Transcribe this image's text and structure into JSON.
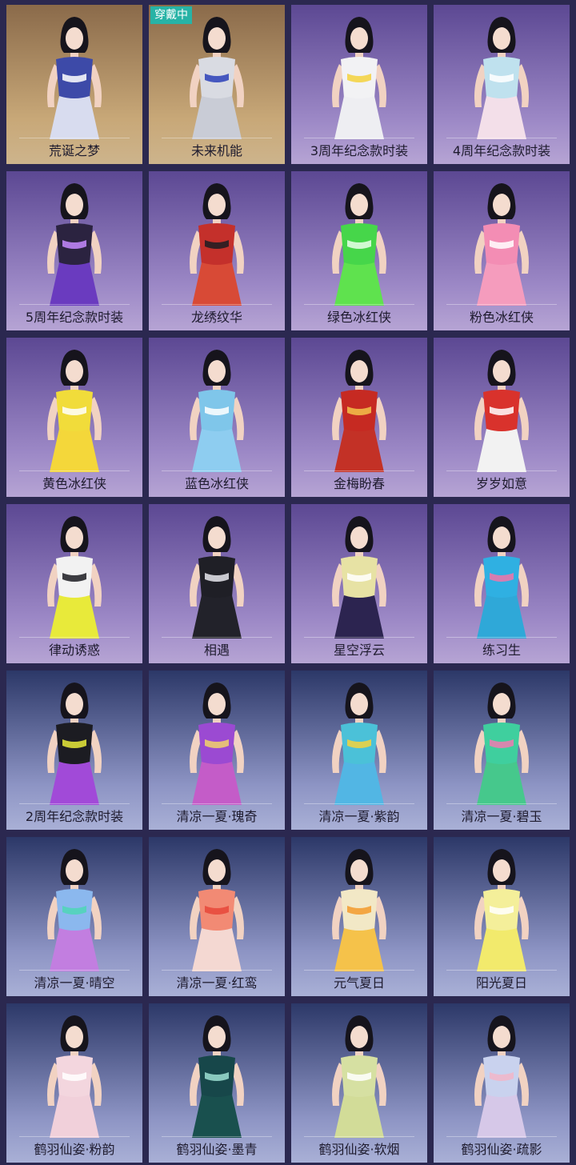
{
  "colors": {
    "page_bg": "#2b2850",
    "badge_bg": "#27b3a6",
    "label_text": "#1e1b2e"
  },
  "wearing_badge": "穿戴中",
  "outfits": [
    {
      "name": "荒诞之梦",
      "wearing": false,
      "bg_top": "#8a6a4a",
      "bg_bottom": "#c8a878",
      "label_bg": "#cdb48c",
      "top": "#3d4aa8",
      "bottom": "#d8dcef",
      "accent": "#ffffff",
      "icon": "character-portrait-icon"
    },
    {
      "name": "未来机能",
      "wearing": true,
      "bg_top": "#8a6a4a",
      "bg_bottom": "#c8a878",
      "label_bg": "#cdb48c",
      "top": "#d9dbe2",
      "bottom": "#c9ccd6",
      "accent": "#2a3fb8",
      "icon": "character-portrait-icon"
    },
    {
      "name": "3周年纪念款时装",
      "wearing": false,
      "bg_top": "#5c4893",
      "bg_bottom": "#9c88c6",
      "label_bg": "#b6a4d4",
      "top": "#f2f2f4",
      "bottom": "#eeeef2",
      "accent": "#f4d23c",
      "icon": "character-portrait-icon"
    },
    {
      "name": "4周年纪念款时装",
      "wearing": false,
      "bg_top": "#5c4893",
      "bg_bottom": "#9c88c6",
      "label_bg": "#b6a4d4",
      "top": "#bfe1ee",
      "bottom": "#f3dfe9",
      "accent": "#ffffff",
      "icon": "character-portrait-icon"
    },
    {
      "name": "5周年纪念款时装",
      "wearing": false,
      "bg_top": "#5c4893",
      "bg_bottom": "#9c88c6",
      "label_bg": "#b6a4d4",
      "top": "#2b2340",
      "bottom": "#6a3bbf",
      "accent": "#c58aff",
      "icon": "character-portrait-icon"
    },
    {
      "name": "龙绣纹华",
      "wearing": false,
      "bg_top": "#5c4893",
      "bg_bottom": "#9c88c6",
      "label_bg": "#b6a4d4",
      "top": "#c4302b",
      "bottom": "#d84a36",
      "accent": "#1c1c22",
      "icon": "character-portrait-icon"
    },
    {
      "name": "绿色冰红侠",
      "wearing": false,
      "bg_top": "#5c4893",
      "bg_bottom": "#9c88c6",
      "label_bg": "#b6a4d4",
      "top": "#46d64a",
      "bottom": "#5fe24e",
      "accent": "#eaffea",
      "icon": "character-portrait-icon"
    },
    {
      "name": "粉色冰红侠",
      "wearing": false,
      "bg_top": "#5c4893",
      "bg_bottom": "#9c88c6",
      "label_bg": "#b6a4d4",
      "top": "#f38db4",
      "bottom": "#f59cbd",
      "accent": "#ffffff",
      "icon": "character-portrait-icon"
    },
    {
      "name": "黄色冰红侠",
      "wearing": false,
      "bg_top": "#5c4893",
      "bg_bottom": "#9c88c6",
      "label_bg": "#b6a4d4",
      "top": "#f1dc3a",
      "bottom": "#f4d73a",
      "accent": "#ffffff",
      "icon": "character-portrait-icon"
    },
    {
      "name": "蓝色冰红侠",
      "wearing": false,
      "bg_top": "#5c4893",
      "bg_bottom": "#9c88c6",
      "label_bg": "#b6a4d4",
      "top": "#7fc6ea",
      "bottom": "#8ecdf0",
      "accent": "#ffffff",
      "icon": "character-portrait-icon"
    },
    {
      "name": "金梅盼春",
      "wearing": false,
      "bg_top": "#5c4893",
      "bg_bottom": "#9c88c6",
      "label_bg": "#b6a4d4",
      "top": "#c62a22",
      "bottom": "#c33126",
      "accent": "#f2c24a",
      "icon": "character-portrait-icon"
    },
    {
      "name": "岁岁如意",
      "wearing": false,
      "bg_top": "#5c4893",
      "bg_bottom": "#9c88c6",
      "label_bg": "#b6a4d4",
      "top": "#d9322c",
      "bottom": "#f2f2f2",
      "accent": "#ffffff",
      "icon": "character-portrait-icon"
    },
    {
      "name": "律动诱惑",
      "wearing": false,
      "bg_top": "#5c4893",
      "bg_bottom": "#9c88c6",
      "label_bg": "#b6a4d4",
      "top": "#f2f2f2",
      "bottom": "#e8ea3a",
      "accent": "#1c1c22",
      "icon": "character-portrait-icon"
    },
    {
      "name": "相遇",
      "wearing": false,
      "bg_top": "#5c4893",
      "bg_bottom": "#9c88c6",
      "label_bg": "#b6a4d4",
      "top": "#1f1f26",
      "bottom": "#22222a",
      "accent": "#e8e8ee",
      "icon": "character-portrait-icon"
    },
    {
      "name": "星空浮云",
      "wearing": false,
      "bg_top": "#5c4893",
      "bg_bottom": "#9c88c6",
      "label_bg": "#b6a4d4",
      "top": "#e7e2a4",
      "bottom": "#2c2450",
      "accent": "#ffffff",
      "icon": "character-portrait-icon"
    },
    {
      "name": "练习生",
      "wearing": false,
      "bg_top": "#5c4893",
      "bg_bottom": "#9c88c6",
      "label_bg": "#b6a4d4",
      "top": "#2fb0e2",
      "bottom": "#2fa8d8",
      "accent": "#f274a8",
      "icon": "character-portrait-icon"
    },
    {
      "name": "2周年纪念款时装",
      "wearing": false,
      "bg_top": "#2c3868",
      "bg_bottom": "#8d94c4",
      "label_bg": "#a9b0d6",
      "top": "#1c1c22",
      "bottom": "#a14ad8",
      "accent": "#e7ea3a",
      "icon": "character-portrait-icon"
    },
    {
      "name": "清凉一夏·瑰奇",
      "wearing": false,
      "bg_top": "#2c3868",
      "bg_bottom": "#8d94c4",
      "label_bg": "#a9b0d6",
      "top": "#9b4ad2",
      "bottom": "#c45cc8",
      "accent": "#f2d26a",
      "icon": "character-portrait-icon"
    },
    {
      "name": "清凉一夏·紫韵",
      "wearing": false,
      "bg_top": "#2c3868",
      "bg_bottom": "#8d94c4",
      "label_bg": "#a9b0d6",
      "top": "#4bc1d8",
      "bottom": "#52b6e4",
      "accent": "#f5d23c",
      "icon": "character-portrait-icon"
    },
    {
      "name": "清凉一夏·碧玉",
      "wearing": false,
      "bg_top": "#2c3868",
      "bg_bottom": "#8d94c4",
      "label_bg": "#a9b0d6",
      "top": "#3fcf9e",
      "bottom": "#46c88c",
      "accent": "#f07ab0",
      "icon": "character-portrait-icon"
    },
    {
      "name": "清凉一夏·晴空",
      "wearing": false,
      "bg_top": "#2c3868",
      "bg_bottom": "#8d94c4",
      "label_bg": "#a9b0d6",
      "top": "#8bb8ee",
      "bottom": "#c27ee0",
      "accent": "#4ed6b6",
      "icon": "character-portrait-icon"
    },
    {
      "name": "清凉一夏·红鸾",
      "wearing": false,
      "bg_top": "#2c3868",
      "bg_bottom": "#8d94c4",
      "label_bg": "#a9b0d6",
      "top": "#f28a74",
      "bottom": "#f4d8d2",
      "accent": "#e8463a",
      "icon": "character-portrait-icon"
    },
    {
      "name": "元气夏日",
      "wearing": false,
      "bg_top": "#2c3868",
      "bg_bottom": "#8d94c4",
      "label_bg": "#a9b0d6",
      "top": "#f2e8c6",
      "bottom": "#f5c24a",
      "accent": "#f39a2c",
      "icon": "character-portrait-icon"
    },
    {
      "name": "阳光夏日",
      "wearing": false,
      "bg_top": "#2c3868",
      "bg_bottom": "#8d94c4",
      "label_bg": "#a9b0d6",
      "top": "#f4ef9a",
      "bottom": "#f2ea6c",
      "accent": "#ffffff",
      "icon": "character-portrait-icon"
    },
    {
      "name": "鹤羽仙姿·粉韵",
      "wearing": false,
      "bg_top": "#2c3868",
      "bg_bottom": "#8d94c4",
      "label_bg": "#a9b0d6",
      "top": "#f3d6de",
      "bottom": "#f1d0da",
      "accent": "#ffffff",
      "icon": "character-portrait-icon"
    },
    {
      "name": "鹤羽仙姿·墨青",
      "wearing": false,
      "bg_top": "#2c3868",
      "bg_bottom": "#8d94c4",
      "label_bg": "#a9b0d6",
      "top": "#17474a",
      "bottom": "#19504e",
      "accent": "#9ee0d2",
      "icon": "character-portrait-icon"
    },
    {
      "name": "鹤羽仙姿·软烟",
      "wearing": false,
      "bg_top": "#2c3868",
      "bg_bottom": "#8d94c4",
      "label_bg": "#a9b0d6",
      "top": "#d6e0a2",
      "bottom": "#d2dc98",
      "accent": "#ffffff",
      "icon": "character-portrait-icon"
    },
    {
      "name": "鹤羽仙姿·疏影",
      "wearing": false,
      "bg_top": "#2c3868",
      "bg_bottom": "#8d94c4",
      "label_bg": "#a9b0d6",
      "top": "#c9d2ee",
      "bottom": "#d6c8e8",
      "accent": "#f2b6c8",
      "icon": "character-portrait-icon"
    }
  ]
}
